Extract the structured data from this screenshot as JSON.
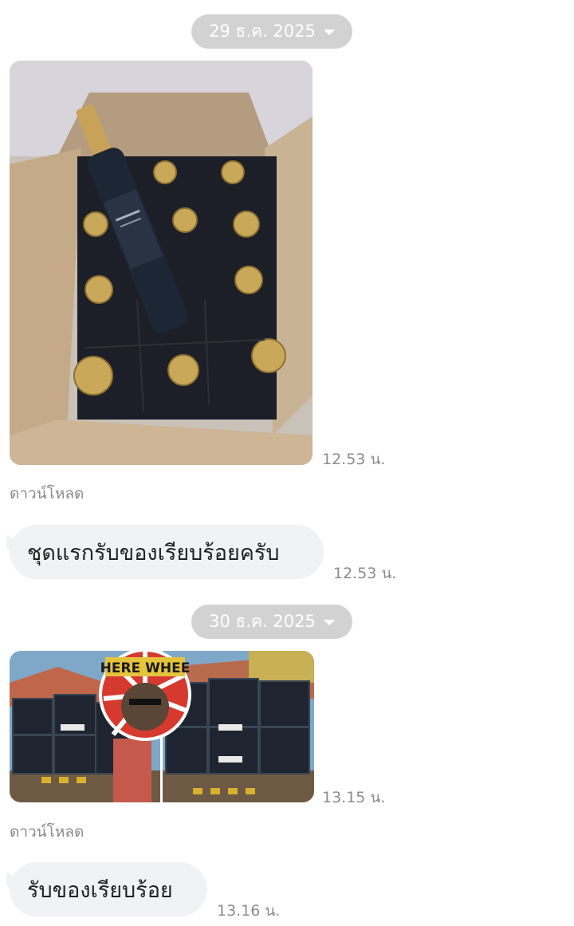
{
  "messages": [
    {
      "type": "date",
      "label": "29 ธ.ค. 2025"
    },
    {
      "type": "image",
      "time": "12.53 น.",
      "download": "ดาวน์โหลด",
      "desc": "wine-box-photo"
    },
    {
      "type": "text",
      "text": "ชุดแรกรับของเรียบร้อยครับ",
      "time": "12.53 น."
    },
    {
      "type": "date",
      "label": "30 ธ.ค. 2025"
    },
    {
      "type": "image",
      "time": "13.15 น.",
      "download": "ดาวน์โหลด",
      "desc": "stacked-boxes-photo",
      "logo_text": "HERE WHEE"
    },
    {
      "type": "text",
      "text": "รับของเรียบร้อย",
      "time": "13.16 น."
    }
  ]
}
